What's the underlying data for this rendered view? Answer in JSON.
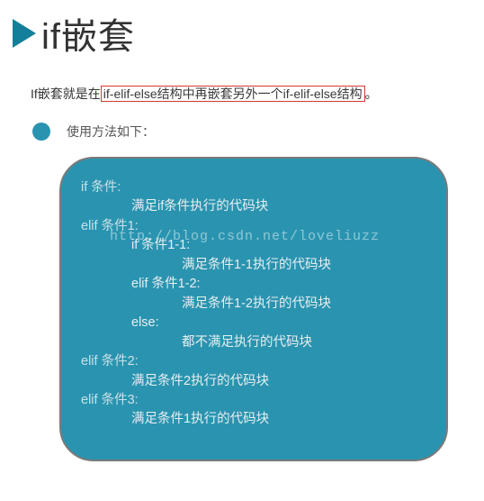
{
  "title": "if嵌套",
  "description": {
    "prefix": "If嵌套就是在",
    "highlight": "if-elif-else结构中再嵌套另外一个if-elif-else结构",
    "suffix": "。"
  },
  "usage_label": "使用方法如下：",
  "watermark": "http://blog.csdn.net/loveliuzz",
  "code_lines": [
    {
      "indent": 0,
      "text": "if 条件:",
      "cls": "cond"
    },
    {
      "indent": 1,
      "text": "满足if条件执行的代码块",
      "cls": ""
    },
    {
      "indent": 0,
      "text": "elif 条件1:",
      "cls": "cond"
    },
    {
      "indent": 1,
      "text": "if 条件1-1:",
      "cls": ""
    },
    {
      "indent": 2,
      "text": "满足条件1-1执行的代码块",
      "cls": ""
    },
    {
      "indent": 1,
      "text": "elif 条件1-2:",
      "cls": ""
    },
    {
      "indent": 2,
      "text": "满足条件1-2执行的代码块",
      "cls": ""
    },
    {
      "indent": 1,
      "text": "else:",
      "cls": ""
    },
    {
      "indent": 2,
      "text": "都不满足执行的代码块",
      "cls": ""
    },
    {
      "indent": 0,
      "text": "elif 条件2:",
      "cls": "cond"
    },
    {
      "indent": 1,
      "text": "满足条件2执行的代码块",
      "cls": ""
    },
    {
      "indent": 0,
      "text": "elif 条件3:",
      "cls": "cond"
    },
    {
      "indent": 1,
      "text": "满足条件1执行的代码块",
      "cls": ""
    }
  ]
}
